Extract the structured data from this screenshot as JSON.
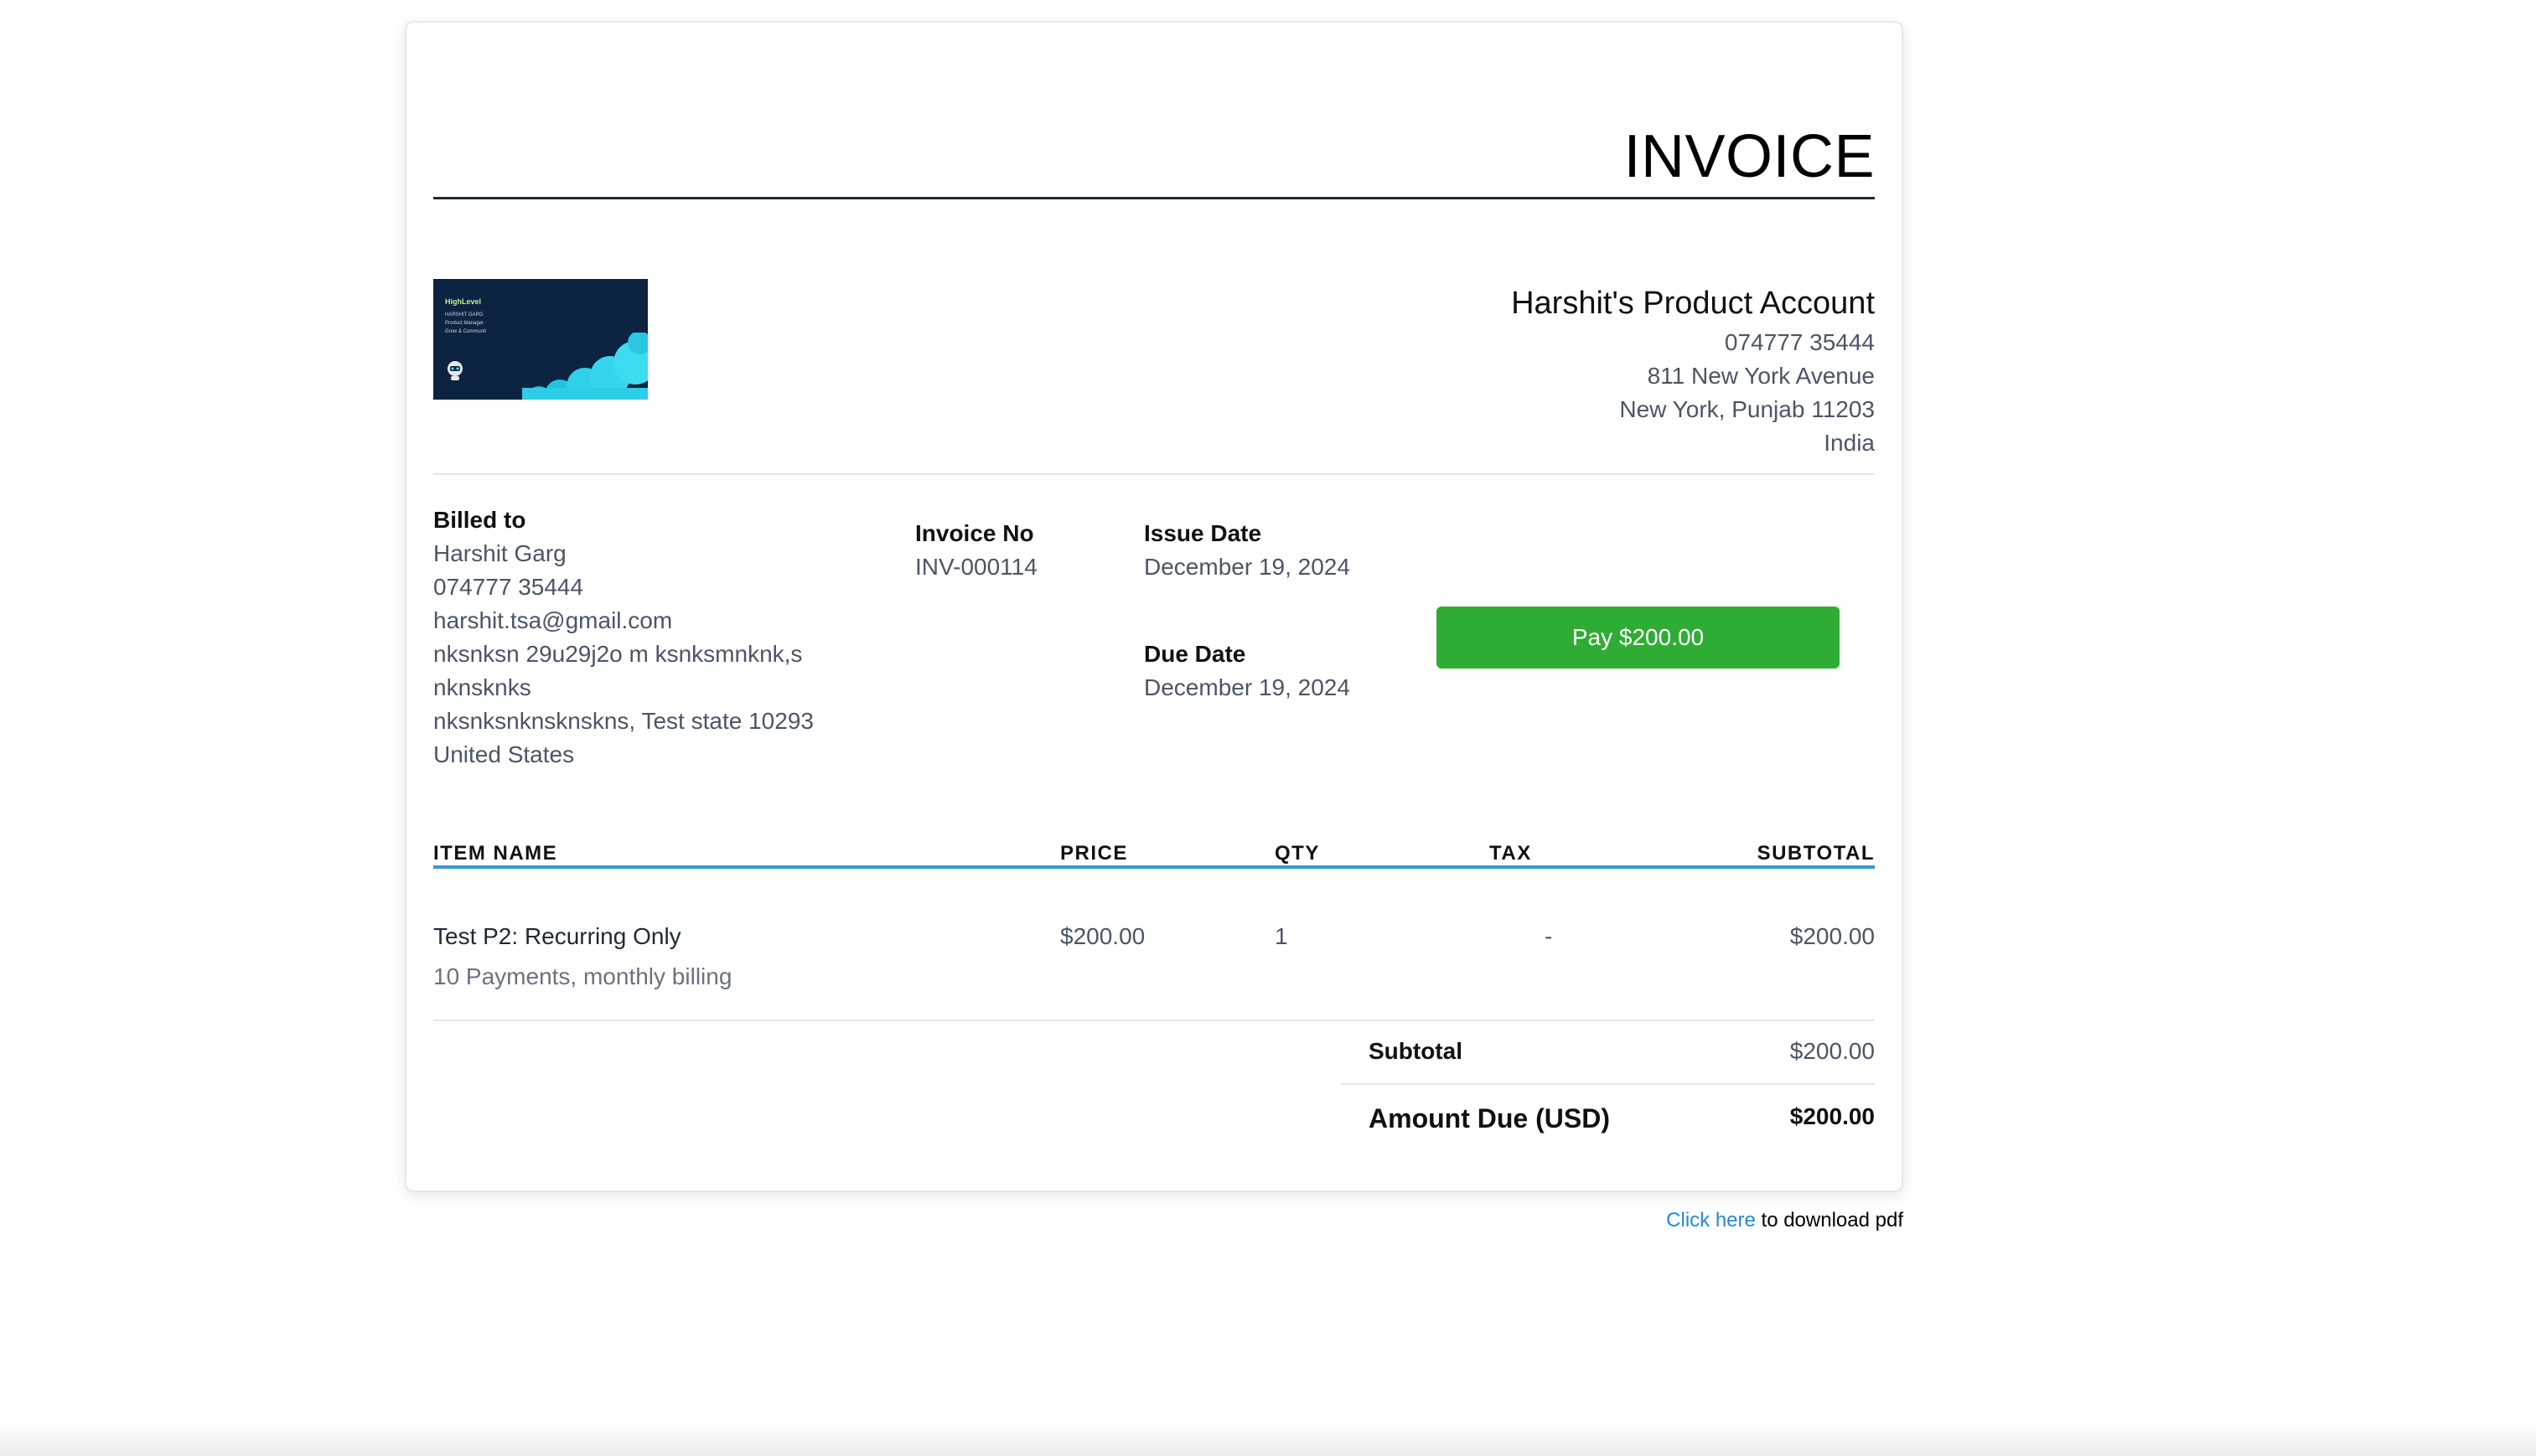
{
  "invoice": {
    "heading": "INVOICE",
    "logo_brand": "HighLevel",
    "logo_lines": [
      "HARSHIT GARG",
      "Product Manager",
      "Grow & Communit"
    ],
    "company": {
      "name": "Harshit's Product Account",
      "phone": "074777 35444",
      "address1": "811 New York Avenue",
      "address2": "New York, Punjab 11203",
      "country": "India"
    },
    "billed_to": {
      "label": "Billed to",
      "name": "Harshit Garg",
      "phone": "074777 35444",
      "email": "harshit.tsa@gmail.com",
      "address1": "nksnksn 29u29j2o m ksnksmnknk,s",
      "address2": "nknsknks",
      "address3": "nksnksnknsknskns, Test state 10293",
      "country": "United States"
    },
    "invoice_no": {
      "label": "Invoice No",
      "value": "INV-000114"
    },
    "issue_date": {
      "label": "Issue Date",
      "value": "December 19, 2024"
    },
    "due_date": {
      "label": "Due Date",
      "value": "December 19, 2024"
    },
    "pay_button": "Pay $200.00",
    "table": {
      "headers": {
        "item": "ITEM NAME",
        "price": "PRICE",
        "qty": "QTY",
        "tax": "TAX",
        "subtotal": "SUBTOTAL"
      },
      "rows": [
        {
          "name": "Test P2: Recurring Only",
          "description": "10 Payments, monthly billing",
          "price": "$200.00",
          "qty": "1",
          "tax": "-",
          "subtotal": "$200.00"
        }
      ]
    },
    "summary": {
      "subtotal_label": "Subtotal",
      "subtotal_value": "$200.00",
      "amount_due_label": "Amount Due (USD)",
      "amount_due_value": "$200.00"
    }
  },
  "footer": {
    "link_text": "Click here",
    "suffix": " to download pdf"
  },
  "colors": {
    "pay_button": "#2fac34",
    "table_rule": "#3b97d3",
    "link": "#2688d1",
    "logo_bg": "#0d2342"
  }
}
